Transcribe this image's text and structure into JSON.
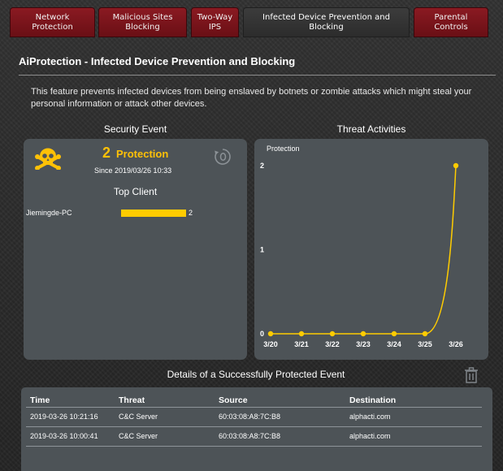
{
  "tabs": [
    {
      "label": "Network\nProtection"
    },
    {
      "label": "Malicious Sites\nBlocking"
    },
    {
      "label": "Two-Way\nIPS"
    },
    {
      "label": "Infected Device Prevention and\nBlocking"
    },
    {
      "label": "Parental\nControls"
    }
  ],
  "header": {
    "title": "AiProtection - Infected Device Prevention and Blocking",
    "description": "This feature prevents infected devices from being enslaved by botnets or zombie attacks which might steal your personal information or attack other devices."
  },
  "security_event": {
    "heading": "Security Event",
    "count": "2",
    "count_label": "Protection",
    "since": "Since 2019/03/26 10:33",
    "top_client_heading": "Top Client",
    "clients": [
      {
        "name": "Jiemingde-PC",
        "value": 2,
        "value_text": "2"
      }
    ],
    "client_max": 2,
    "skull_color": "#ffc107",
    "accent": "#ffcc00"
  },
  "threat_activities": {
    "heading": "Threat Activities"
  },
  "chart_data": {
    "type": "line",
    "title": "Protection",
    "categories": [
      "3/20",
      "3/21",
      "3/22",
      "3/23",
      "3/24",
      "3/25",
      "3/26"
    ],
    "values": [
      0,
      0,
      0,
      0,
      0,
      0,
      2
    ],
    "y_ticks": [
      "0",
      "1",
      "2"
    ],
    "ylim": [
      0,
      2
    ],
    "grid": false,
    "line_color": "#ffcc00"
  },
  "details": {
    "heading": "Details of a Successfully Protected Event",
    "columns": [
      "Time",
      "Threat",
      "Source",
      "Destination"
    ],
    "rows": [
      {
        "time": "2019-03-26 10:21:16",
        "threat": "C&C Server",
        "source": "60:03:08:A8:7C:B8",
        "destination": "alphacti.com"
      },
      {
        "time": "2019-03-26 10:00:41",
        "threat": "C&C Server",
        "source": "60:03:08:A8:7C:B8",
        "destination": "alphacti.com"
      }
    ]
  },
  "icons": {
    "skull": "skull-crossbones-icon",
    "reset": "reset-counter-icon",
    "trash": "trash-icon"
  }
}
